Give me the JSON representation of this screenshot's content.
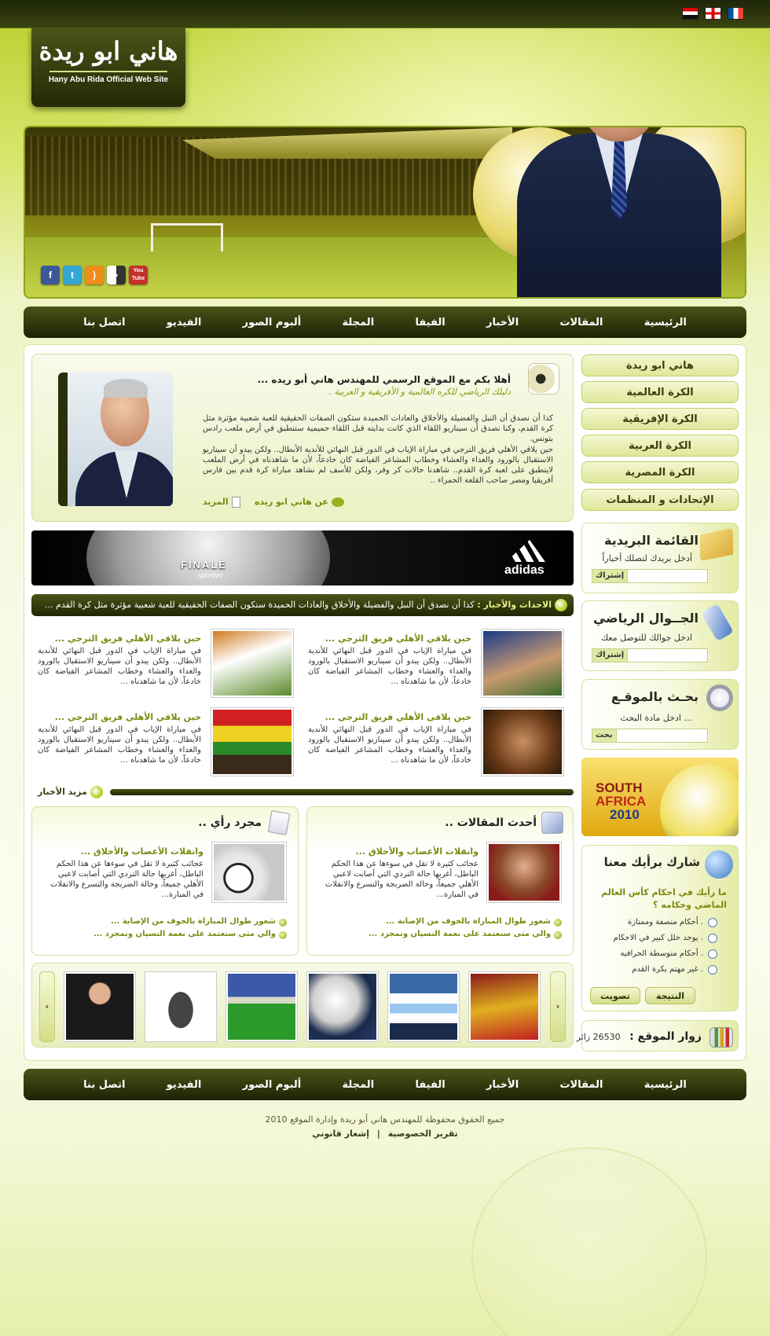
{
  "site": {
    "logo_ar": "هاني ابو ريدة",
    "logo_en": "Hany Abu Rida Official Web Site"
  },
  "flags": [
    "eg",
    "en",
    "fr"
  ],
  "social": [
    {
      "name": "facebook-icon",
      "glyph": "f",
      "color": "#3b5998"
    },
    {
      "name": "twitter-icon",
      "glyph": "t",
      "color": "#33a7d6"
    },
    {
      "name": "rss-icon",
      "glyph": ")",
      "color": "#f08c1a"
    },
    {
      "name": "delicious-icon",
      "glyph": "▪",
      "color": "#444"
    },
    {
      "name": "youtube-icon",
      "glyph": "You Tube",
      "color": "#c4302b"
    }
  ],
  "nav": [
    "الرئيسية",
    "المقالات",
    "الأخبار",
    "الفيفا",
    "المجلة",
    "ألبوم الصور",
    "الفيديو",
    "اتصل بنا"
  ],
  "side_menu": [
    "هاني ابو ريدة",
    "الكرة العالمية",
    "الكرة الإفريقية",
    "الكرة العربية",
    "الكرة المصرية",
    "الإتحادات و المنظمات"
  ],
  "welcome": {
    "title": "أهلا بكم مع الموقع الرسمي للمهندس هاني أبو ريده ...",
    "subtitle": "دليلك الرياضي للكره العالمية و الأفريقية و العربية .",
    "p1": "كذا أن نصدق أن النبل والفضيلة والأخلاق والعادات الحميدة ستكون الصفات الحقيقية للعبة شعبية مؤثرة مثل كرة القدم، وكنا نصدق أن سيناريو اللقاء الذي كانت بدايته قبل اللقاء حميمية ستنطبق في أرض ملعب رادس بتونس.",
    "p2": "حين يلاقي الأهلي فريق الترجي في مباراة الإياب في الدور قبل النهائي للأندية الأبطال.. ولكن يبدو أن سيناريو الاستقبال بالورود والغداء والعشاء وخطاب المشاعر الفياضة كان خادعاً، لأن ما شاهدناه في أرض الملعب لاينطبق على لعبة كرة القدم.. شاهدنا حالات كر وفر، ولكن للأسف لم نشاهد مباراة كرة قدم بين فارس أفريقيا ومصر صاحب القلعة الحمراء ..",
    "about": "عن هاني ابو ريده",
    "more": "المزيد"
  },
  "ad": {
    "brand": "adidas",
    "ball_text": "FINALE",
    "ball_sub": "sportivo"
  },
  "ticker": {
    "label": "الاحداث والأخبار :",
    "text": "كذا أن نصدق أن النبل والفضيلة والأخلاق والعادات الحميدة ستكون الصفات الحقيقية للعبة شعبية مؤثرة مثل كرة القدم ..."
  },
  "news": [
    {
      "title": "حين يلاقي الأهلي فريق الترجي ...",
      "body": "في مباراة الإياب في الدور قبل النهائي للأندية الأبطال.. ولكن يبدو أن سيناريو الاستقبال بالورود والغداء والعشاء وخطاب المشاعر الفياضة كان خادعاً، لأن ما شاهدناه ..."
    },
    {
      "title": "حين يلاقي الأهلي فريق الترجي ...",
      "body": "في مباراة الإياب في الدور قبل النهائي للأندية الأبطال.. ولكن يبدو أن سيناريو الاستقبال بالورود والغداء والعشاء وخطاب المشاعر الفياضة كان خادعاً، لأن ما شاهدناه ..."
    },
    {
      "title": "حين يلاقي الأهلي فريق الترجي ...",
      "body": "في مباراة الإياب في الدور قبل النهائي للأندية الأبطال.. ولكن يبدو أن سيناريو الاستقبال بالورود والغداء والعشاء وخطاب المشاعر الفياضة كان خادعاً، لأن ما شاهدناه ..."
    },
    {
      "title": "حين يلاقي الأهلي فريق الترجي ...",
      "body": "في مباراة الإياب في الدور قبل النهائي للأندية الأبطال.. ولكن يبدو أن سيناريو الاستقبال بالورود والغداء والعشاء وخطاب المشاعر الفياضة كان خادعاً، لأن ما شاهدناه ..."
    }
  ],
  "more_news": "مزيد الأخبار",
  "articles": {
    "title": "أحدث المقالات ..",
    "item_title": "وانفلات الأعصاب والأخلاق ...",
    "item_body": "عجائب كثيرة لا تقل في سوءها عن هذا الحكم الباطل، أغربها حالة التردي التي أصابت لاعبي الأهلي جميعاً، وحالة الضربجة والتسرع والانفلات في المبارة...",
    "links": [
      "شعور طوال المباراة بالخوف من الإصابة ...",
      "والي متى سنعتمد على نعمة النسيان ونمجرد ..."
    ]
  },
  "opinion": {
    "title": "مجرد رأي ..",
    "item_title": "وانفلات الأعصاب والأخلاق ...",
    "item_body": "عجائب كثيرة لا تقل في سوءها عن هذا الحكم الباطل، أغربها حالة التردي التي أصابت لاعبي الأهلي جميعاً، وحالة الضربجة والتسرع والانفلات في المبارة...",
    "links": [
      "شعور طوال المباراة بالخوف من الإصابة ...",
      "والي متى سنعتمد على نعمة النسيان ونمجرد ..."
    ]
  },
  "newsletter": {
    "title": "القائمة البريدية",
    "label": "أدخل بريدك لتصلك أخباراً",
    "button": "إشتراك"
  },
  "mobile": {
    "title": "الجــوال الرياضي",
    "label": "ادخل جوالك للتوصل معك",
    "button": "إشتراك"
  },
  "search": {
    "title": "بحـث بالموقـع",
    "label": "ادخل مادة البحث ...",
    "button": "بحث"
  },
  "sa": {
    "line1": "SOUTH",
    "line2": "AFRICA",
    "line3": "2010"
  },
  "poll": {
    "title": "شارك برأيك معنا",
    "question": "ما رأيك في احكام كأس العالم الماضي وحكامه ؟",
    "options": [
      "أحكام منصفة وممتازة .",
      "يوجد خلل كبير في الاحكام .",
      "أحكام متوسطة الحرافية .",
      "غير مهتم بكرة القدم ."
    ],
    "vote": "تصويت",
    "result": "النتيجة"
  },
  "visitors": {
    "label": "زوار الموقع :",
    "count": "26530 زائر"
  },
  "footer": {
    "copyright": "جميع الحقوق محفوظة للمهندس هاني أبو ريدة وإدارة الموقع 2010",
    "privacy": "تقرير الخصوصية",
    "sep": "|",
    "legal": "إشعار قانوني"
  }
}
